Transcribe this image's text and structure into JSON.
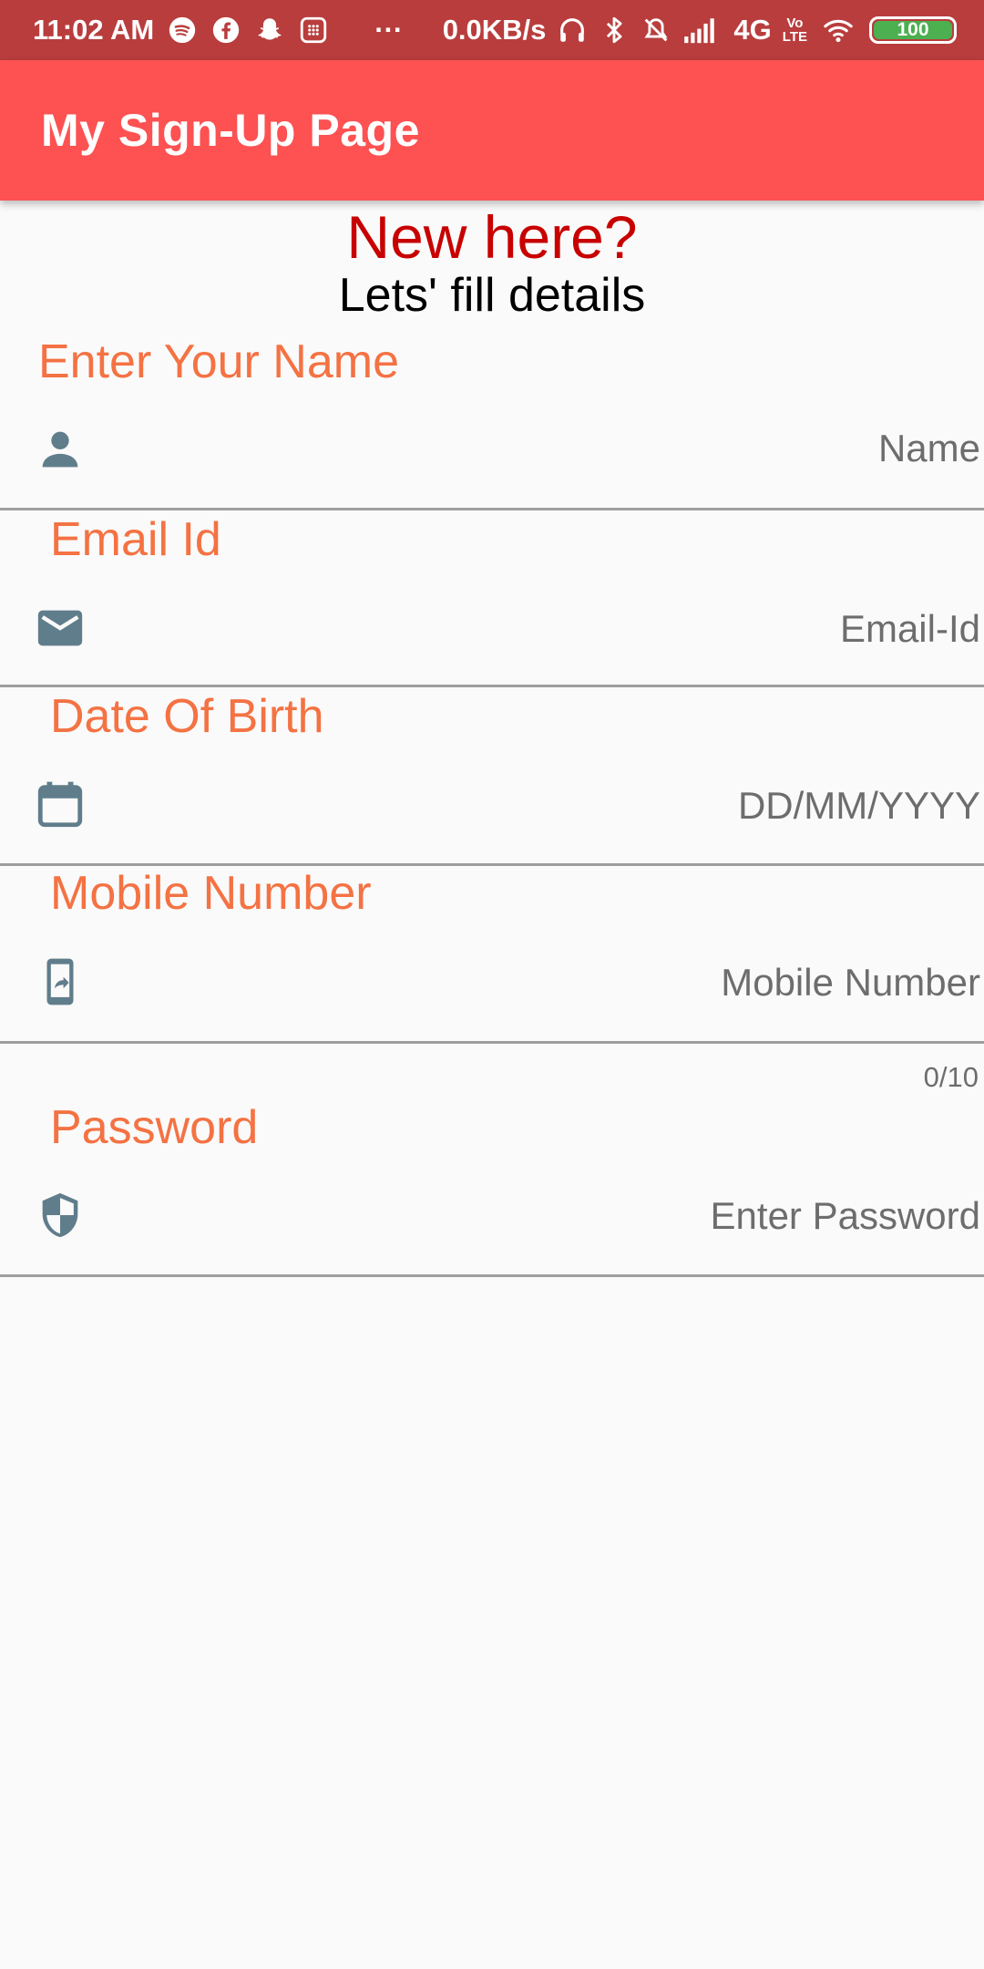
{
  "status_bar": {
    "time": "11:02 AM",
    "more": "···",
    "net_speed": "0.0KB/s",
    "network_type": "4G",
    "volte_top": "Vo",
    "volte_bottom": "LTE",
    "battery": "100",
    "icons": [
      "spotify-icon",
      "facebook-icon",
      "snapchat-icon",
      "sms-icon",
      "headphones-icon",
      "bluetooth-icon",
      "vibrate-off-icon",
      "signal-icon",
      "wifi-icon",
      "battery-icon"
    ]
  },
  "app_bar": {
    "title": "My Sign-Up Page",
    "color": "#fd5152"
  },
  "heading": {
    "title": "New here?",
    "subtitle": "Lets' fill details"
  },
  "form": {
    "name": {
      "label": "Enter Your Name",
      "placeholder": "Name",
      "icon": "person-icon",
      "value": ""
    },
    "email": {
      "label": "Email Id",
      "placeholder": "Email-Id",
      "icon": "mail-icon",
      "value": ""
    },
    "dob": {
      "label": "Date Of Birth",
      "placeholder": "DD/MM/YYYY",
      "icon": "calendar-icon",
      "value": ""
    },
    "mobile": {
      "label": "Mobile Number",
      "placeholder": "Mobile Number",
      "icon": "phone-forward-icon",
      "value": "",
      "counter": "0/10"
    },
    "password": {
      "label": "Password",
      "placeholder": "Enter Password",
      "icon": "security-shield-icon",
      "value": ""
    }
  },
  "colors": {
    "status_bar": "#b93d3d",
    "label": "#f47243",
    "heading": "#c80000",
    "icon": "#607d8b"
  }
}
